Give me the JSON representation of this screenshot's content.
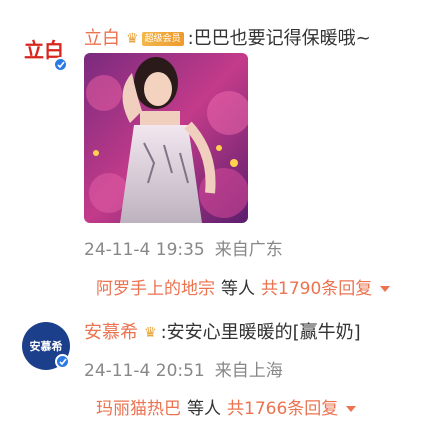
{
  "comments": [
    {
      "avatar_text": "立白",
      "username": "立白",
      "vip_tag": "超级会员",
      "separator": ":",
      "text": "巴巴也要记得保暖哦~",
      "date": "24-11-4 19:35",
      "source": "来自广东",
      "reply_user": "阿罗手上的地宗",
      "reply_etc": "等人",
      "reply_count": "共1790条回复",
      "colors": {
        "avatar_bg": "#ffffff",
        "avatar_text": "#d7261e"
      }
    },
    {
      "avatar_text": "安慕希",
      "username": "安慕希",
      "separator": ":",
      "text": "安安心里暖暖的[赢牛奶]",
      "date": "24-11-4 20:51",
      "source": "来自上海",
      "reply_user": "玛丽猫热巴",
      "reply_etc": "等人",
      "reply_count": "共1766条回复",
      "colors": {
        "avatar_bg": "#1c3f8c",
        "avatar_text": "#ffffff"
      }
    }
  ],
  "icons": {
    "crown": "crown-icon",
    "verified": "verified-badge-icon",
    "expand": "chevron-down-icon"
  },
  "colors": {
    "accent": "#eb7350",
    "meta": "#888888",
    "verified": "#2c7be5"
  }
}
